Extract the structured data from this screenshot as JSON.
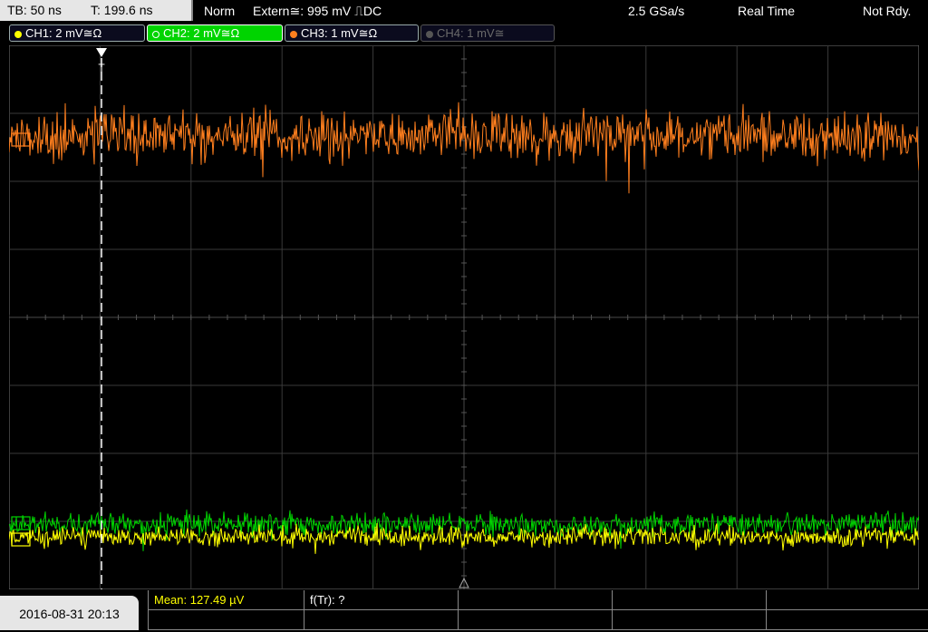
{
  "status": {
    "timebase": "TB: 50 ns",
    "trigger_time": "T: 199.6 ns",
    "mode": "Norm",
    "trigger_source": "Extern≅: 995 mV ⎍DC",
    "sample_rate": "2.5 GSa/s",
    "acq_mode": "Real Time",
    "state": "Not Rdy."
  },
  "channels": [
    {
      "label": "CH1: 2 mV≅Ω",
      "color": "#ffff00",
      "active": false
    },
    {
      "label": "CH2: 2 mV≅Ω",
      "color": "#00d400",
      "active": true
    },
    {
      "label": "CH3: 1 mV≅Ω",
      "color": "#ff7f1e",
      "active": false
    },
    {
      "label": "CH4: 1 mV≅",
      "color": "#6a6a6a",
      "active": false
    }
  ],
  "screen": {
    "trigger_marker": "T",
    "grid_color": "#3a3a3a",
    "background": "#000000"
  },
  "footer": {
    "datetime": "2016-08-31 20:13",
    "measurements": [
      {
        "label": "Mean: 127.49 µV",
        "color": "#ffff00"
      },
      {
        "label": "f(Tr): ?",
        "color": "#ffffff"
      }
    ]
  }
}
